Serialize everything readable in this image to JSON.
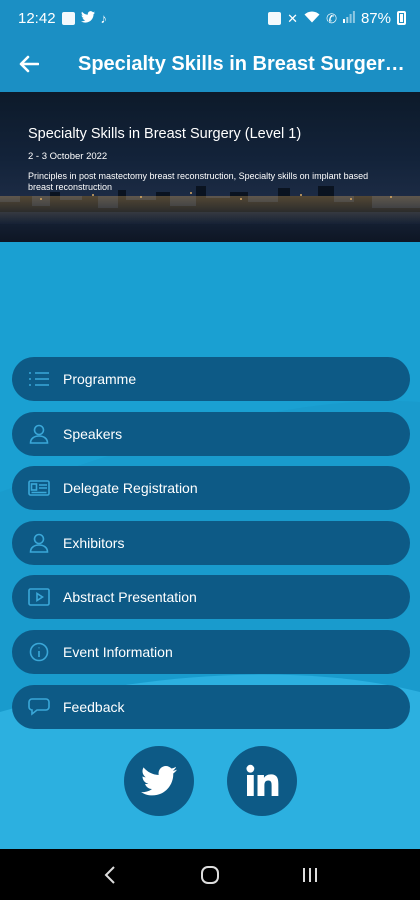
{
  "status_bar": {
    "time": "12:42",
    "battery": "87%",
    "left_icons": [
      "gallery-icon",
      "twitter-icon",
      "tiktok-icon"
    ],
    "right_icons": [
      "nfc-icon",
      "mute-icon",
      "wifi-icon",
      "calling-icon",
      "signal-icon",
      "battery-icon"
    ]
  },
  "app_bar": {
    "title": "Specialty Skills in Breast Surger…",
    "back_icon": "arrow-left-icon"
  },
  "banner": {
    "title": "Specialty Skills in Breast Surgery (Level 1)",
    "date": "2 - 3 October 2022",
    "description": "Principles in post mastectomy breast reconstruction, Specialty skills on implant based breast reconstruction"
  },
  "menu": {
    "items": [
      {
        "label": "Programme",
        "icon": "list-icon"
      },
      {
        "label": "Speakers",
        "icon": "person-icon"
      },
      {
        "label": "Delegate Registration",
        "icon": "id-card-icon"
      },
      {
        "label": "Exhibitors",
        "icon": "person-icon"
      },
      {
        "label": "Abstract Presentation",
        "icon": "video-icon"
      },
      {
        "label": "Event Information",
        "icon": "info-icon"
      },
      {
        "label": "Feedback",
        "icon": "chat-icon"
      }
    ]
  },
  "social": {
    "twitter_icon": "twitter-icon",
    "linkedin_icon": "linkedin-icon"
  },
  "colors": {
    "background": "#1aa0d2",
    "app_bar": "#1b8fc4",
    "menu_item": "#0d5a86",
    "icon_stroke": "#3aa7d8"
  }
}
